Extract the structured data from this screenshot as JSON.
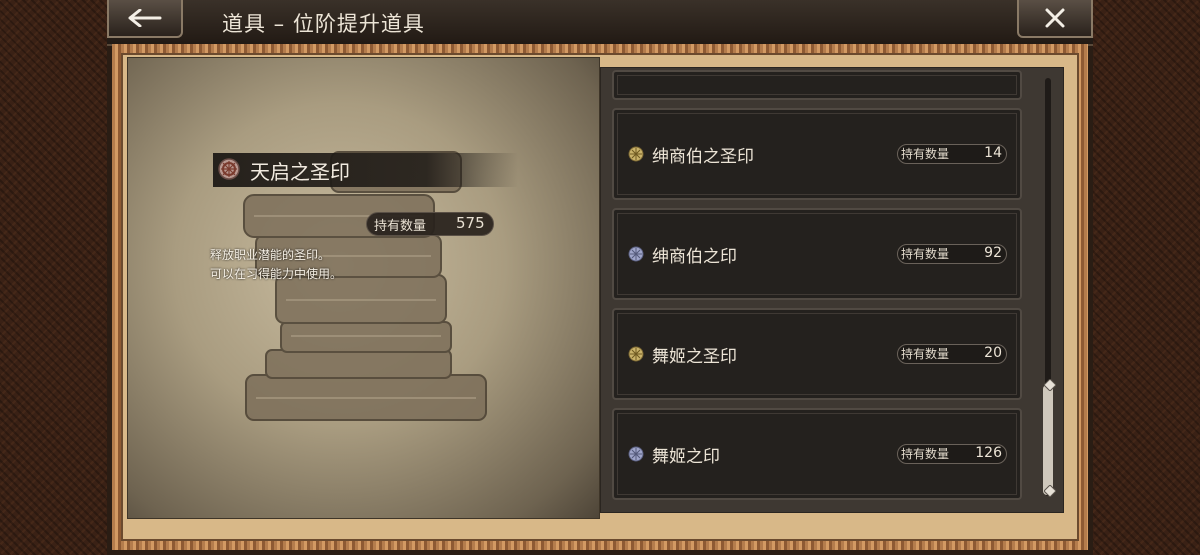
{
  "header": {
    "title": "道具 – 位阶提升道具",
    "back_icon": "arrow-left-icon",
    "close_icon": "close-x-icon"
  },
  "detail": {
    "name": "天启之圣印",
    "quantity_label": "持有数量",
    "quantity": "575",
    "description_lines": [
      "释放职业潜能的圣印。",
      "可以在习得能力中使用。"
    ],
    "icon": "seal-emblem-icon"
  },
  "list": {
    "items": [
      {
        "name": "绅商伯之圣印",
        "quantity_label": "持有数量",
        "quantity": "14",
        "icon": "gold-seal-icon",
        "icon_color": "#c9b26a"
      },
      {
        "name": "绅商伯之印",
        "quantity_label": "持有数量",
        "quantity": "92",
        "icon": "silver-seal-icon",
        "icon_color": "#9fa5c9"
      },
      {
        "name": "舞姬之圣印",
        "quantity_label": "持有数量",
        "quantity": "20",
        "icon": "gold-seal-icon",
        "icon_color": "#c9b26a"
      },
      {
        "name": "舞姬之印",
        "quantity_label": "持有数量",
        "quantity": "126",
        "icon": "silver-seal-icon",
        "icon_color": "#9fa5c9"
      }
    ]
  },
  "colors": {
    "accent_frame": "#b47c4c",
    "panel_bg": "#24211e"
  }
}
